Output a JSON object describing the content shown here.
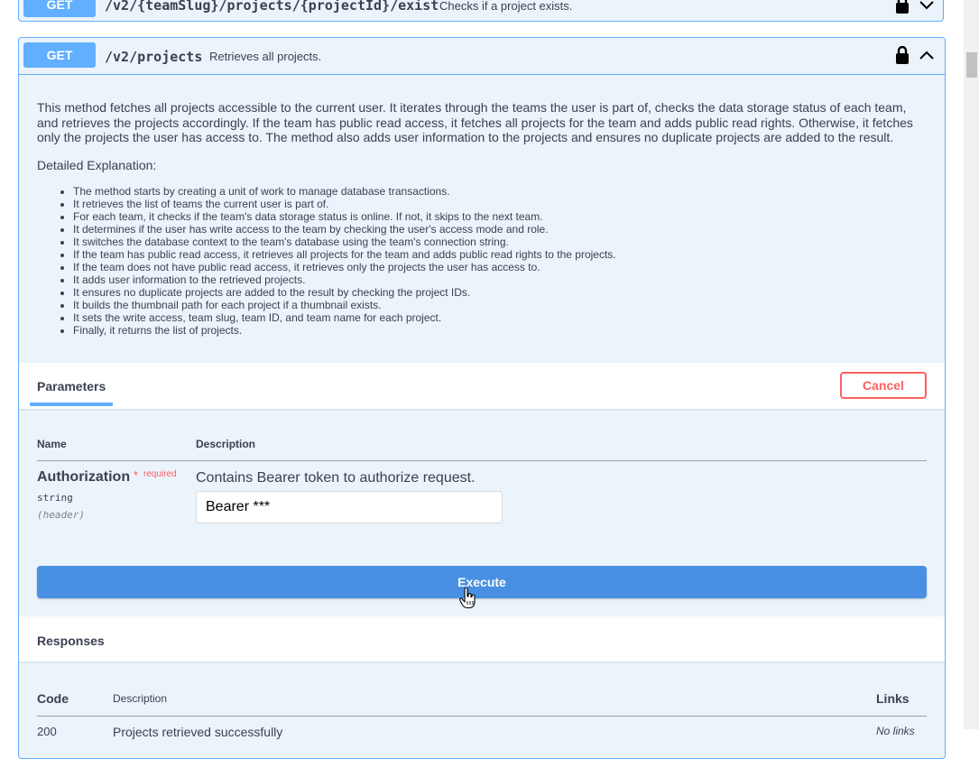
{
  "previous_operation": {
    "method": "GET",
    "path": "/v2/{teamSlug}/projects/{projectId}/exist",
    "summary": "Checks if a project exists.",
    "lock_icon": "lock-icon",
    "toggle_icon": "chevron-down-icon"
  },
  "operation": {
    "method": "GET",
    "path": "/v2/projects",
    "summary": "Retrieves all projects.",
    "lock_icon": "lock-icon",
    "toggle_icon": "chevron-up-icon",
    "description": "This method fetches all projects accessible to the current user. It iterates through the teams the user is part of, checks the data storage status of each team, and retrieves the projects accordingly. If the team has public read access, it fetches all projects for the team and adds public read rights. Otherwise, it fetches only the projects the user has access to. The method also adds user information to the projects and ensures no duplicate projects are added to the result.",
    "detail_heading": "Detailed Explanation:",
    "details": [
      "The method starts by creating a unit of work to manage database transactions.",
      "It retrieves the list of teams the current user is part of.",
      "For each team, it checks if the team's data storage status is online. If not, it skips to the next team.",
      "It determines if the user has write access to the team by checking the user's access mode and role.",
      "It switches the database context to the team's database using the team's connection string.",
      "If the team has public read access, it retrieves all projects for the team and adds public read rights to the projects.",
      "If the team does not have public read access, it retrieves only the projects the user has access to.",
      "It adds user information to the retrieved projects.",
      "It ensures no duplicate projects are added to the result by checking the project IDs.",
      "It builds the thumbnail path for each project if a thumbnail exists.",
      "It sets the write access, team slug, team ID, and team name for each project.",
      "Finally, it returns the list of projects."
    ]
  },
  "parameters": {
    "tab_label": "Parameters",
    "cancel_label": "Cancel",
    "col_name": "Name",
    "col_description": "Description",
    "items": [
      {
        "name": "Authorization",
        "required_star": "*",
        "required_label": "required",
        "type": "string",
        "in": "(header)",
        "description": "Contains Bearer token to authorize request.",
        "value": "Bearer ***"
      }
    ]
  },
  "execute_label": "Execute",
  "cursor_icon": "hand-pointer-icon",
  "responses": {
    "title": "Responses",
    "col_code": "Code",
    "col_description": "Description",
    "col_links": "Links",
    "rows": [
      {
        "code": "200",
        "description": "Projects retrieved successfully",
        "links": "No links"
      }
    ]
  },
  "colors": {
    "get": "#61affe",
    "get_bg": "#ebf3fb",
    "execute": "#4990e2",
    "cancel": "#ff6060",
    "text": "#3b4151"
  }
}
